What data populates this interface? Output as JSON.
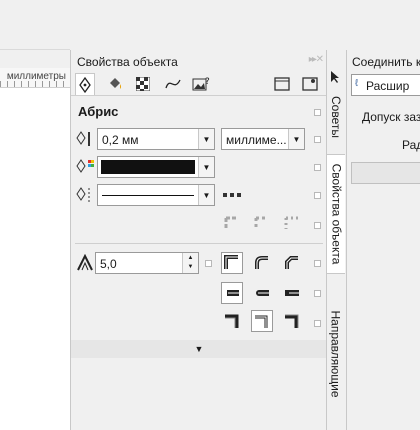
{
  "canvas": {
    "ruler_label": "миллиметры"
  },
  "docker": {
    "title": "Свойства объекта",
    "tabs": [
      {
        "icon": "pen-nib-icon"
      },
      {
        "icon": "fill-bucket-icon"
      },
      {
        "icon": "transparency-checker-icon"
      },
      {
        "icon": "curve-icon"
      },
      {
        "icon": "image-question-icon"
      }
    ],
    "section_title": "Абрис",
    "width_value": "0,2 мм",
    "units_value": "миллиме...",
    "miter_value": "5,0",
    "colors": {
      "outline": "#111111",
      "accent_arrow": "#e02020"
    }
  },
  "vertical_tabs": {
    "tips": "Советы",
    "properties": "Свойства объекта",
    "guides": "Направляющие"
  },
  "right_panel": {
    "title": "Соединить к",
    "dropdown_value": "Расшир",
    "tolerance_label": "Допуск заз",
    "radius_label": "Рад"
  }
}
